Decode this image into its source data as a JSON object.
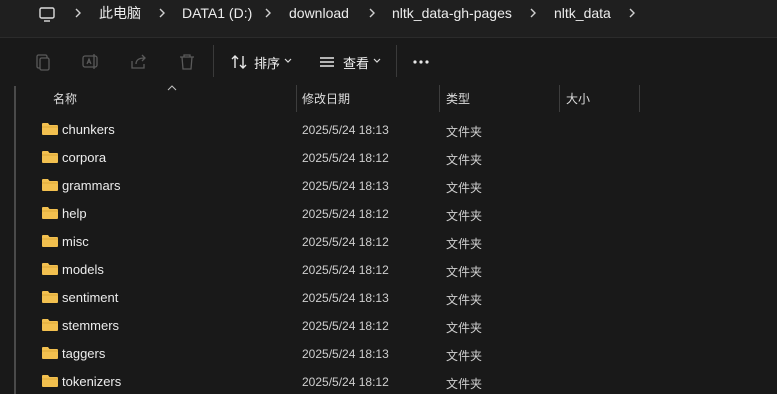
{
  "address_bar": {
    "root_icon": "this-pc-monitor-icon",
    "breadcrumbs": [
      "此电脑",
      "DATA1 (D:)",
      "download",
      "nltk_data-gh-pages",
      "nltk_data"
    ]
  },
  "command_bar": {
    "disabled_icons": [
      "copy-icon",
      "rename-icon",
      "share-icon",
      "delete-icon"
    ],
    "sort_label": "排序",
    "view_label": "查看",
    "more_icon": "more-ellipsis-icon"
  },
  "columns": {
    "name": "名称",
    "modified": "修改日期",
    "type": "类型",
    "size": "大小"
  },
  "files": [
    {
      "name": "chunkers",
      "modified": "2025/5/24 18:13",
      "type": "文件夹"
    },
    {
      "name": "corpora",
      "modified": "2025/5/24 18:12",
      "type": "文件夹"
    },
    {
      "name": "grammars",
      "modified": "2025/5/24 18:13",
      "type": "文件夹"
    },
    {
      "name": "help",
      "modified": "2025/5/24 18:12",
      "type": "文件夹"
    },
    {
      "name": "misc",
      "modified": "2025/5/24 18:12",
      "type": "文件夹"
    },
    {
      "name": "models",
      "modified": "2025/5/24 18:12",
      "type": "文件夹"
    },
    {
      "name": "sentiment",
      "modified": "2025/5/24 18:13",
      "type": "文件夹"
    },
    {
      "name": "stemmers",
      "modified": "2025/5/24 18:12",
      "type": "文件夹"
    },
    {
      "name": "taggers",
      "modified": "2025/5/24 18:13",
      "type": "文件夹"
    },
    {
      "name": "tokenizers",
      "modified": "2025/5/24 18:12",
      "type": "文件夹"
    }
  ],
  "colors": {
    "folder": "#f2c04f",
    "background": "#191919"
  }
}
